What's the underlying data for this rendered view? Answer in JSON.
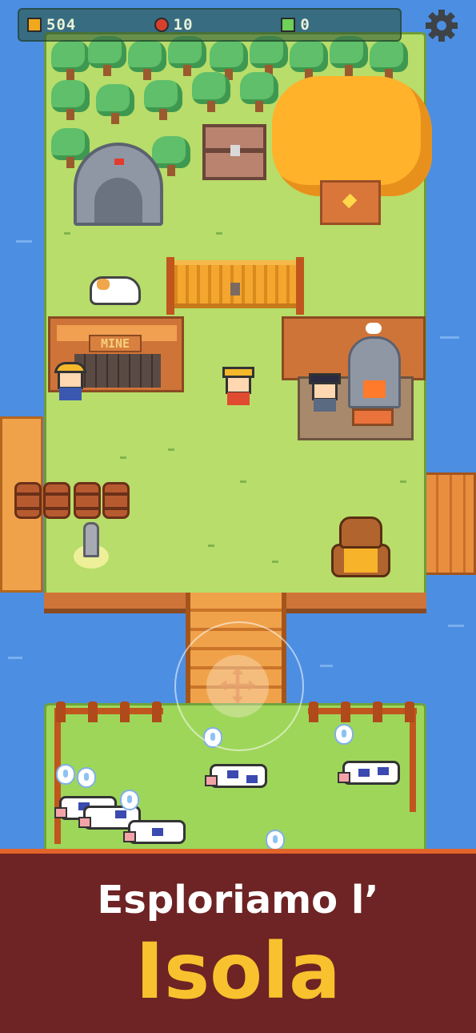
{
  "hud": {
    "gold": {
      "icon": "gold-coin-icon",
      "value": "504",
      "color": "#f2a81e"
    },
    "apples": {
      "icon": "apple-icon",
      "value": "10",
      "color": "#d6402c"
    },
    "gems": {
      "icon": "green-gem-icon",
      "value": "0",
      "color": "#6fd05a"
    },
    "settings_icon": "gear-icon"
  },
  "scene": {
    "mine_sign": "MINE",
    "npcs": [
      "miner",
      "hero-player",
      "blacksmith",
      "bear-merchant"
    ],
    "animals": [
      "cat",
      "cow",
      "cow",
      "cow",
      "cow",
      "cow"
    ]
  },
  "banner": {
    "line1": "Esploriamo l’",
    "line2": "Isola",
    "background": "#6e2324",
    "accent": "#f7c22e"
  }
}
